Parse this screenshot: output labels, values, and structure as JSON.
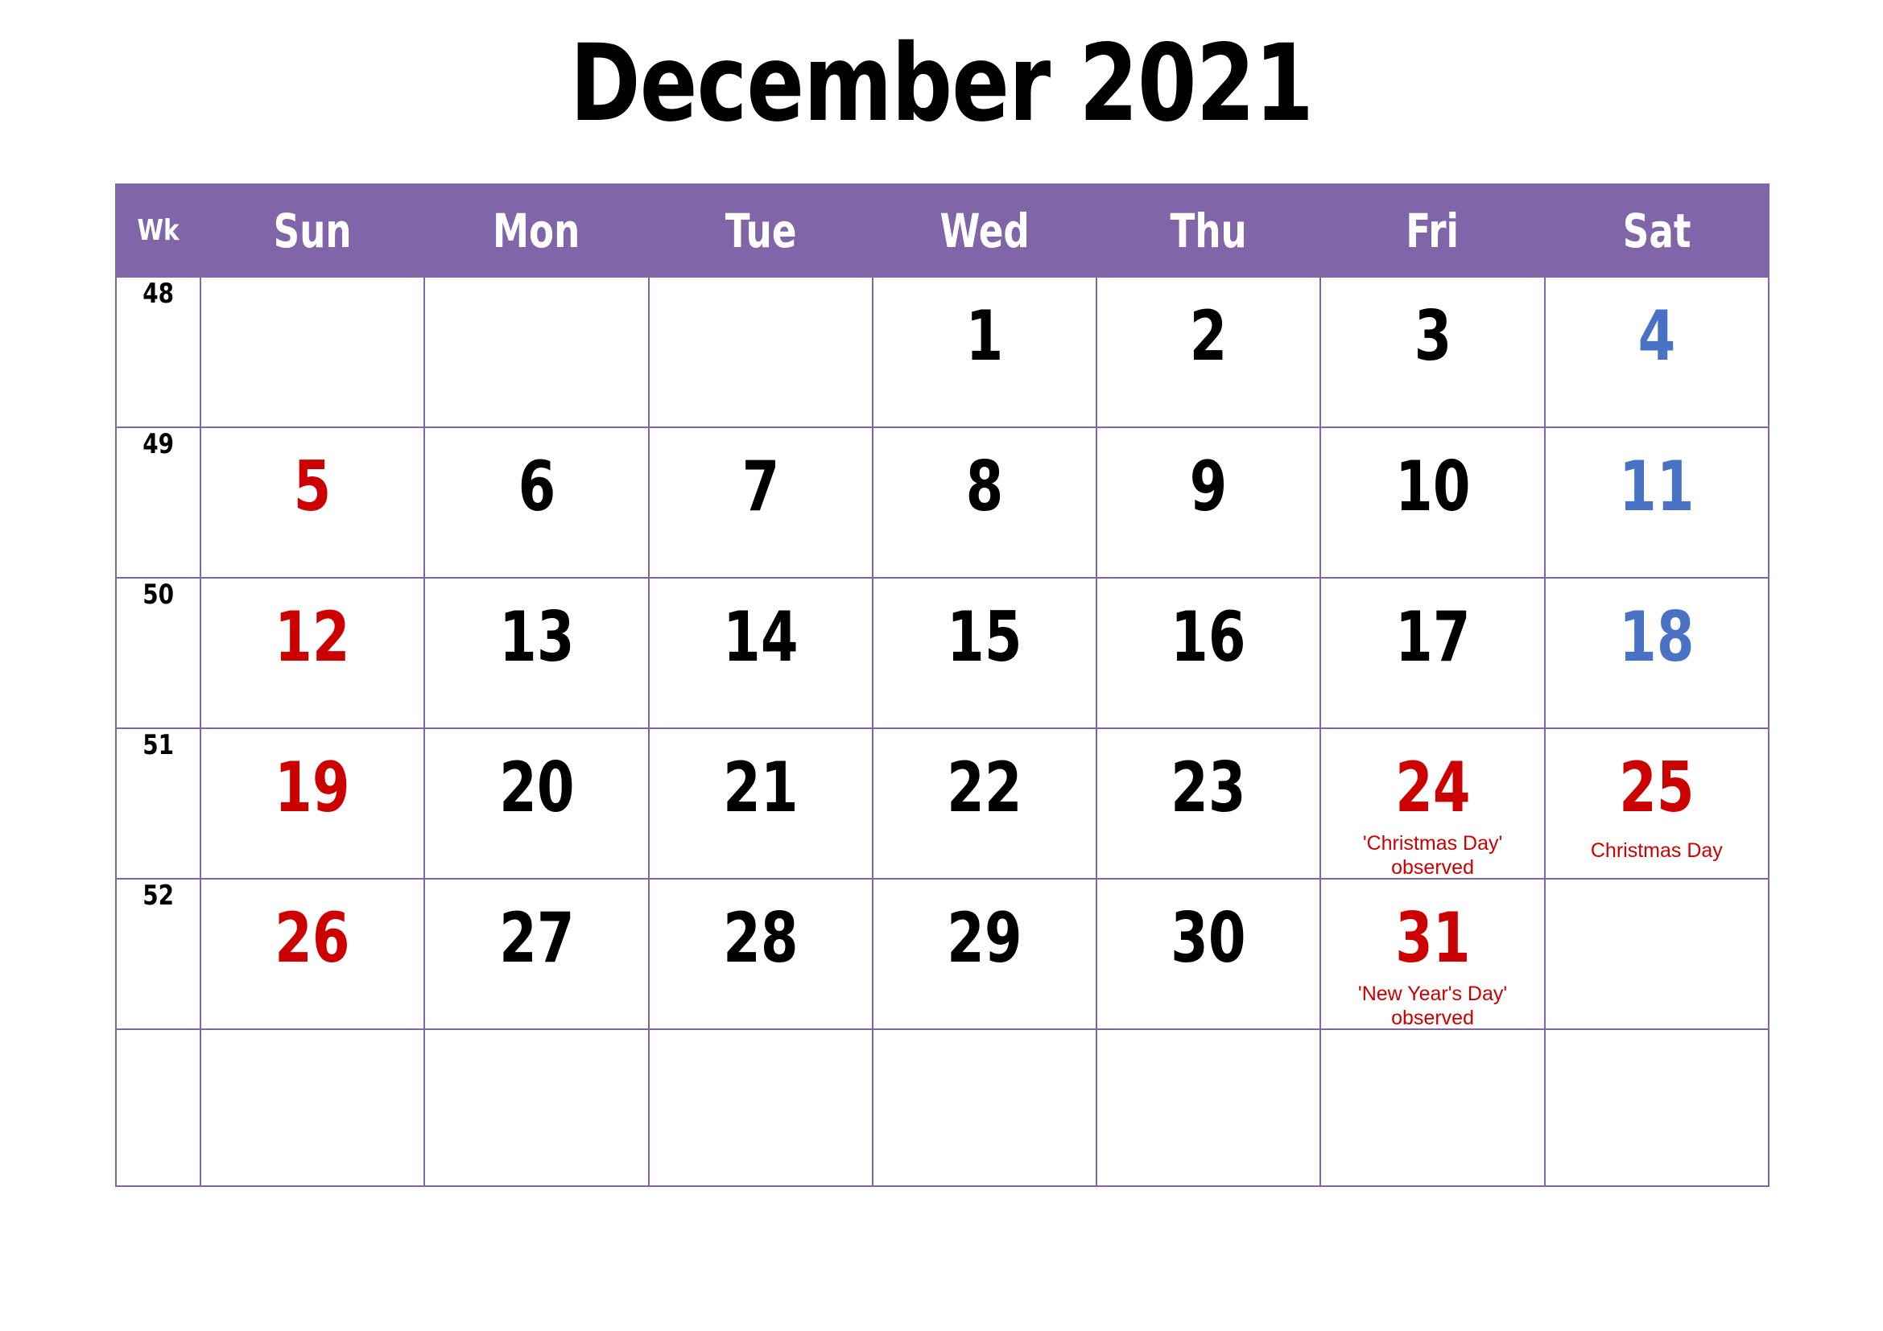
{
  "title": "December 2021",
  "colors": {
    "header_bg": "#8065a8",
    "grid_line": "#8065a8",
    "sunday": "#cc0000",
    "saturday": "#4a72c4",
    "weekday": "#000000",
    "holiday": "#cc0000",
    "page_bg": "#ffffff"
  },
  "header": {
    "week_label": "Wk",
    "days": [
      "Sun",
      "Mon",
      "Tue",
      "Wed",
      "Thu",
      "Fri",
      "Sat"
    ]
  },
  "weeks": [
    {
      "wk": "48",
      "days": [
        {
          "num": "",
          "kind": "empty",
          "note": ""
        },
        {
          "num": "",
          "kind": "empty",
          "note": ""
        },
        {
          "num": "",
          "kind": "empty",
          "note": ""
        },
        {
          "num": "1",
          "kind": "weekday",
          "note": ""
        },
        {
          "num": "2",
          "kind": "weekday",
          "note": ""
        },
        {
          "num": "3",
          "kind": "weekday",
          "note": ""
        },
        {
          "num": "4",
          "kind": "sat",
          "note": ""
        }
      ]
    },
    {
      "wk": "49",
      "days": [
        {
          "num": "5",
          "kind": "sun",
          "note": ""
        },
        {
          "num": "6",
          "kind": "weekday",
          "note": ""
        },
        {
          "num": "7",
          "kind": "weekday",
          "note": ""
        },
        {
          "num": "8",
          "kind": "weekday",
          "note": ""
        },
        {
          "num": "9",
          "kind": "weekday",
          "note": ""
        },
        {
          "num": "10",
          "kind": "weekday",
          "note": ""
        },
        {
          "num": "11",
          "kind": "sat",
          "note": ""
        }
      ]
    },
    {
      "wk": "50",
      "days": [
        {
          "num": "12",
          "kind": "sun",
          "note": ""
        },
        {
          "num": "13",
          "kind": "weekday",
          "note": ""
        },
        {
          "num": "14",
          "kind": "weekday",
          "note": ""
        },
        {
          "num": "15",
          "kind": "weekday",
          "note": ""
        },
        {
          "num": "16",
          "kind": "weekday",
          "note": ""
        },
        {
          "num": "17",
          "kind": "weekday",
          "note": ""
        },
        {
          "num": "18",
          "kind": "sat",
          "note": ""
        }
      ]
    },
    {
      "wk": "51",
      "days": [
        {
          "num": "19",
          "kind": "sun",
          "note": ""
        },
        {
          "num": "20",
          "kind": "weekday",
          "note": ""
        },
        {
          "num": "21",
          "kind": "weekday",
          "note": ""
        },
        {
          "num": "22",
          "kind": "weekday",
          "note": ""
        },
        {
          "num": "23",
          "kind": "weekday",
          "note": ""
        },
        {
          "num": "24",
          "kind": "holiday",
          "note": "'Christmas Day'\nobserved"
        },
        {
          "num": "25",
          "kind": "holiday",
          "note": "Christmas Day"
        }
      ]
    },
    {
      "wk": "52",
      "days": [
        {
          "num": "26",
          "kind": "sun",
          "note": ""
        },
        {
          "num": "27",
          "kind": "weekday",
          "note": ""
        },
        {
          "num": "28",
          "kind": "weekday",
          "note": ""
        },
        {
          "num": "29",
          "kind": "weekday",
          "note": ""
        },
        {
          "num": "30",
          "kind": "weekday",
          "note": ""
        },
        {
          "num": "31",
          "kind": "holiday",
          "note": "'New Year's Day'\nobserved"
        },
        {
          "num": "",
          "kind": "empty",
          "note": ""
        }
      ]
    },
    {
      "wk": "",
      "days": [
        {
          "num": "",
          "kind": "empty",
          "note": ""
        },
        {
          "num": "",
          "kind": "empty",
          "note": ""
        },
        {
          "num": "",
          "kind": "empty",
          "note": ""
        },
        {
          "num": "",
          "kind": "empty",
          "note": ""
        },
        {
          "num": "",
          "kind": "empty",
          "note": ""
        },
        {
          "num": "",
          "kind": "empty",
          "note": ""
        },
        {
          "num": "",
          "kind": "empty",
          "note": ""
        }
      ]
    }
  ]
}
